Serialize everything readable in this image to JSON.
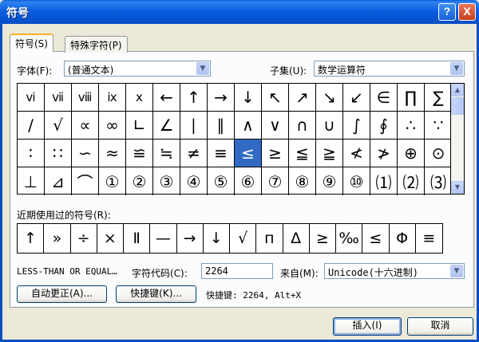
{
  "window": {
    "title": "符号"
  },
  "tabs": [
    {
      "label": "符号(S)"
    },
    {
      "label": "特殊字符(P)"
    }
  ],
  "font": {
    "label": "字体(F):",
    "value": "(普通文本)"
  },
  "subset": {
    "label": "子集(U):",
    "value": "数学运算符"
  },
  "symbols": [
    [
      "ⅵ",
      "ⅶ",
      "ⅷ",
      "ⅸ",
      "ⅹ",
      "←",
      "↑",
      "→",
      "↓",
      "↖",
      "↗",
      "↘",
      "↙",
      "∈",
      "∏",
      "∑"
    ],
    [
      "∕",
      "√",
      "∝",
      "∞",
      "∟",
      "∠",
      "∣",
      "∥",
      "∧",
      "∨",
      "∩",
      "∪",
      "∫",
      "∮",
      "∴",
      "∵"
    ],
    [
      "∶",
      "∷",
      "∽",
      "≈",
      "≌",
      "≒",
      "≠",
      "≡",
      "≤",
      "≥",
      "≦",
      "≧",
      "≮",
      "≯",
      "⊕",
      "⊙"
    ],
    [
      "⊥",
      "⊿",
      "⌒",
      "①",
      "②",
      "③",
      "④",
      "⑤",
      "⑥",
      "⑦",
      "⑧",
      "⑨",
      "⑩",
      "⑴",
      "⑵",
      "⑶"
    ]
  ],
  "selected_cell": {
    "row": 2,
    "col": 8
  },
  "recent": {
    "label": "近期使用过的符号(R):",
    "symbols": [
      "↑",
      "»",
      "÷",
      "×",
      "Ⅱ",
      "—",
      "→",
      "↓",
      "√",
      "п",
      "Δ",
      "≥",
      "‰",
      "≤",
      "Φ",
      "≡"
    ]
  },
  "char_name": "LESS-THAN OR EQUAL…",
  "char_code": {
    "label": "字符代码(C):",
    "value": "2264"
  },
  "from": {
    "label": "来自(M):",
    "value": "Unicode(十六进制)"
  },
  "buttons": {
    "autocorrect": "自动更正(A)...",
    "shortcut_key": "快捷键(K)...",
    "insert": "插入(I)",
    "cancel": "取消"
  },
  "shortcut_info": "快捷键: 2264, Alt+X",
  "titlebar_buttons": {
    "help": "?",
    "close": "X"
  }
}
